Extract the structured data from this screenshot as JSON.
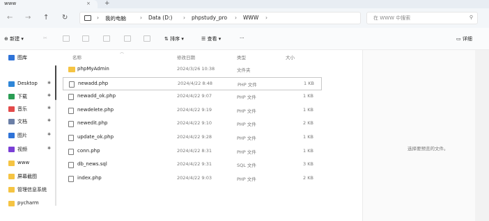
{
  "window": {
    "tab_title": "www",
    "tab_close": "×",
    "tab_add": "+"
  },
  "nav": {
    "back": "←",
    "forward": "→",
    "up": "↑",
    "refresh": "↻"
  },
  "address": {
    "expand": "›",
    "crumbs": [
      "我的电脑",
      "Data (D:)",
      "phpstudy_pro",
      "WWW"
    ],
    "separator": "›"
  },
  "search": {
    "placeholder": "在 WWW 中搜索",
    "icon": "⚲"
  },
  "toolbar": {
    "new_label": "新建",
    "sort_label": "排序",
    "view_label": "查看",
    "more_label": "···",
    "details_label": "详细"
  },
  "sidebar": {
    "items": [
      {
        "label": "图库",
        "icon": "gallery-icon",
        "color": "#2f73d8",
        "pinned": false
      },
      {
        "label": "Desktop",
        "icon": "desktop-icon",
        "color": "#2f86d8",
        "pinned": true
      },
      {
        "label": "下载",
        "icon": "download-icon",
        "color": "#2a9d54",
        "pinned": true
      },
      {
        "label": "音乐",
        "icon": "music-icon",
        "color": "#e34a4a",
        "pinned": true
      },
      {
        "label": "文档",
        "icon": "document-icon",
        "color": "#6b7fa6",
        "pinned": true
      },
      {
        "label": "图片",
        "icon": "picture-icon",
        "color": "#2f73d8",
        "pinned": true
      },
      {
        "label": "视频",
        "icon": "video-icon",
        "color": "#7a3fd6",
        "pinned": true
      },
      {
        "label": "www",
        "icon": "folder-icon",
        "color": "#f5c443",
        "pinned": false
      },
      {
        "label": "屏幕截图",
        "icon": "folder-icon",
        "color": "#f5c443",
        "pinned": false
      },
      {
        "label": "管理信息系统",
        "icon": "folder-icon",
        "color": "#f5c443",
        "pinned": false
      },
      {
        "label": "pycharm",
        "icon": "folder-icon",
        "color": "#f5c443",
        "pinned": false
      }
    ],
    "pin_glyph": "✱"
  },
  "columns": {
    "name": "名称",
    "date": "修改日期",
    "type": "类型",
    "size": "大小"
  },
  "files": [
    {
      "name": "phpMyAdmin",
      "date": "2024/3/26 10:38",
      "type": "文件夹",
      "size": "",
      "kind": "folder"
    },
    {
      "name": "newadd.php",
      "date": "2024/4/22 8:48",
      "type": "PHP 文件",
      "size": "1 KB",
      "kind": "file",
      "selected": true
    },
    {
      "name": "newadd_ok.php",
      "date": "2024/4/22 9:07",
      "type": "PHP 文件",
      "size": "1 KB",
      "kind": "file"
    },
    {
      "name": "newdelete.php",
      "date": "2024/4/22 9:19",
      "type": "PHP 文件",
      "size": "1 KB",
      "kind": "file"
    },
    {
      "name": "newedit.php",
      "date": "2024/4/22 9:10",
      "type": "PHP 文件",
      "size": "2 KB",
      "kind": "file"
    },
    {
      "name": "update_ok.php",
      "date": "2024/4/22 9:28",
      "type": "PHP 文件",
      "size": "1 KB",
      "kind": "file"
    },
    {
      "name": "conn.php",
      "date": "2024/4/22 8:31",
      "type": "PHP 文件",
      "size": "1 KB",
      "kind": "file"
    },
    {
      "name": "db_news.sql",
      "date": "2024/4/22 9:31",
      "type": "SQL 文件",
      "size": "3 KB",
      "kind": "file"
    },
    {
      "name": "index.php",
      "date": "2024/4/22 9:03",
      "type": "PHP 文件",
      "size": "2 KB",
      "kind": "file"
    }
  ],
  "preview": {
    "message": "选择要预览的文件。"
  }
}
